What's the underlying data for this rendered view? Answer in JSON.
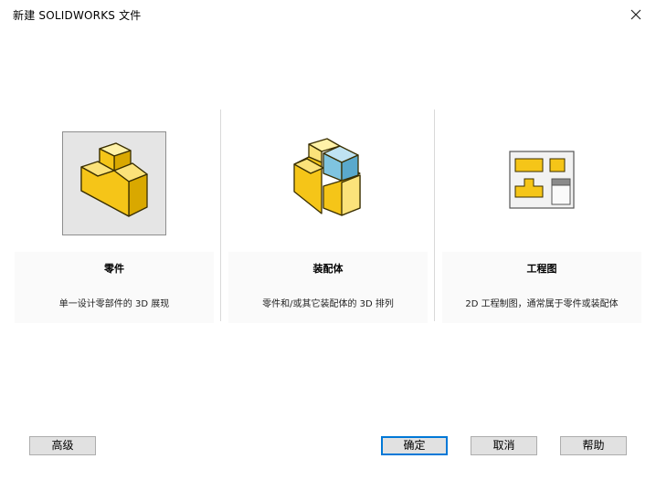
{
  "window": {
    "title": "新建 SOLIDWORKS 文件"
  },
  "options": [
    {
      "id": "part",
      "name": "零件",
      "description": "单一设计零部件的 3D 展现",
      "icon": "part-icon",
      "selected": true
    },
    {
      "id": "assembly",
      "name": "装配体",
      "description": "零件和/或其它装配体的 3D 排列",
      "icon": "assembly-icon",
      "selected": false
    },
    {
      "id": "drawing",
      "name": "工程图",
      "description": "2D 工程制图，通常属于零件或装配体",
      "icon": "drawing-icon",
      "selected": false
    }
  ],
  "buttons": {
    "advanced": "高级",
    "ok": "确定",
    "cancel": "取消",
    "help": "帮助"
  },
  "colors": {
    "part_yellow": "#f5c518",
    "assembly_blue": "#7fc4e0",
    "accent": "#0078d7"
  }
}
